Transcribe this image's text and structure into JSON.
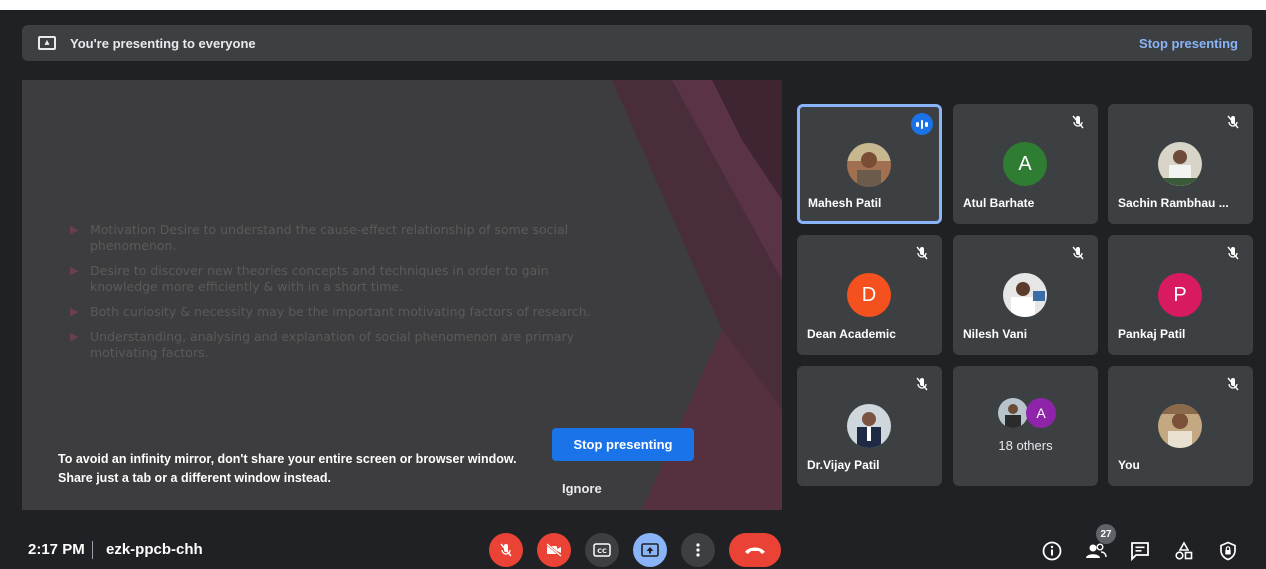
{
  "banner": {
    "message": "You're presenting to everyone",
    "stop_label": "Stop presenting"
  },
  "slide": {
    "bullets": [
      "Motivation Desire to understand the cause-effect relationship of some social phenomenon.",
      "Desire to discover new theories concepts and techniques in order to gain knowledge more efficiently & with in a short time.",
      "Both curiosity & necessity may be the important motivating factors of research.",
      "Understanding, analysing and explanation of social phenomenon are primary motivating factors."
    ]
  },
  "mirror_warning": {
    "message": "To avoid an infinity mirror, don't share your entire screen or browser window. Share just a tab or a different window instead.",
    "stop_label": "Stop presenting",
    "ignore_label": "Ignore"
  },
  "participants": [
    {
      "name": "Mahesh Patil",
      "type": "photo",
      "active": true,
      "speaking": true,
      "muted": false
    },
    {
      "name": "Atul Barhate",
      "type": "letter",
      "letter": "A",
      "color": "#2e7d32",
      "muted": true
    },
    {
      "name": "Sachin Rambhau ...",
      "type": "photo",
      "muted": true
    },
    {
      "name": "Dean Academic",
      "type": "letter",
      "letter": "D",
      "color": "#f4511e",
      "muted": true
    },
    {
      "name": "Nilesh Vani",
      "type": "photo",
      "muted": true
    },
    {
      "name": "Pankaj Patil",
      "type": "letter",
      "letter": "P",
      "color": "#d81b60",
      "muted": true
    },
    {
      "name": "Dr.Vijay Patil",
      "type": "photo",
      "muted": true
    },
    {
      "name": "",
      "type": "group",
      "letter": "A",
      "color": "#8e24aa",
      "others_label": "18 others"
    },
    {
      "name": "You",
      "type": "photo",
      "muted": true
    }
  ],
  "bottom_bar": {
    "time": "2:17 PM",
    "meeting_code": "ezk-ppcb-chh",
    "people_count": "27",
    "controls": [
      "mic-off",
      "camera-off",
      "captions",
      "present",
      "more-options",
      "leave-call"
    ],
    "right_icons": [
      "info",
      "people",
      "chat",
      "activities",
      "host-controls"
    ]
  },
  "colors": {
    "background": "#202124",
    "tile": "#3c4043",
    "accent_blue": "#1a73e8",
    "link_blue": "#8ab4f8",
    "danger_red": "#ea4335"
  }
}
